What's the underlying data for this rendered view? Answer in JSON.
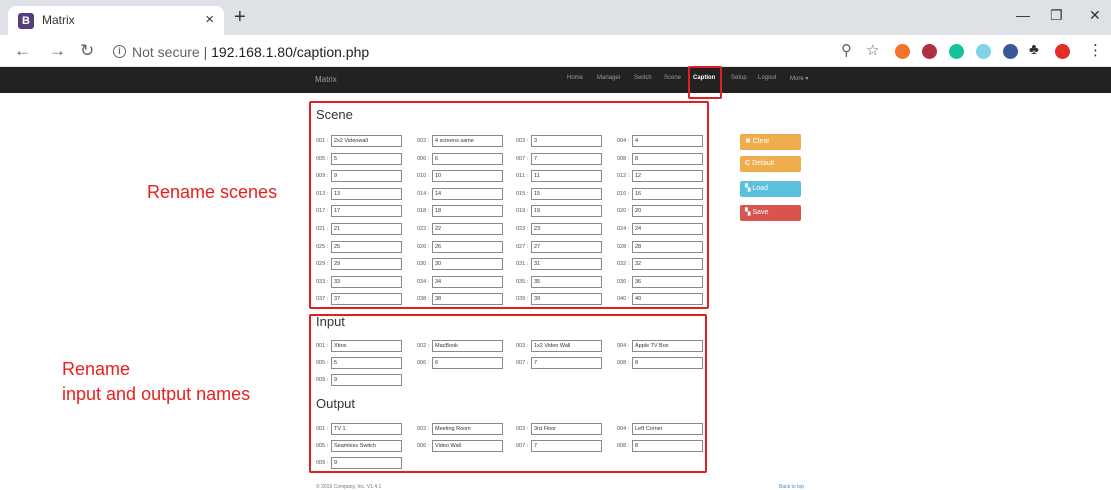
{
  "browser": {
    "tab_title": "Matrix",
    "favicon_letter": "B",
    "new_tab": "+",
    "close_tab": "×",
    "url_security": "Not secure",
    "url_separator": "|",
    "url_host": "192.168.1.80/caption.php"
  },
  "navbar": {
    "brand": "Matrix",
    "items": [
      "Home",
      "Manager",
      "Switch",
      "Scene",
      "Caption",
      "Setup",
      "Logout",
      "More ▾"
    ],
    "active": "Caption"
  },
  "scene": {
    "title": "Scene",
    "items": [
      {
        "label": "001 :",
        "value": "2x2 Videowall"
      },
      {
        "label": "002 :",
        "value": "4 screens same"
      },
      {
        "label": "003 :",
        "value": "3"
      },
      {
        "label": "004 :",
        "value": "4"
      },
      {
        "label": "005 :",
        "value": "5"
      },
      {
        "label": "006 :",
        "value": "6"
      },
      {
        "label": "007 :",
        "value": "7"
      },
      {
        "label": "008 :",
        "value": "8"
      },
      {
        "label": "009 :",
        "value": "9"
      },
      {
        "label": "010 :",
        "value": "10"
      },
      {
        "label": "011 :",
        "value": "11"
      },
      {
        "label": "012 :",
        "value": "12"
      },
      {
        "label": "013 :",
        "value": "13"
      },
      {
        "label": "014 :",
        "value": "14"
      },
      {
        "label": "015 :",
        "value": "15"
      },
      {
        "label": "016 :",
        "value": "16"
      },
      {
        "label": "017 :",
        "value": "17"
      },
      {
        "label": "018 :",
        "value": "18"
      },
      {
        "label": "019 :",
        "value": "19"
      },
      {
        "label": "020 :",
        "value": "20"
      },
      {
        "label": "021 :",
        "value": "21"
      },
      {
        "label": "022 :",
        "value": "22"
      },
      {
        "label": "023 :",
        "value": "23"
      },
      {
        "label": "024 :",
        "value": "24"
      },
      {
        "label": "025 :",
        "value": "25"
      },
      {
        "label": "026 :",
        "value": "26"
      },
      {
        "label": "027 :",
        "value": "27"
      },
      {
        "label": "028 :",
        "value": "28"
      },
      {
        "label": "029 :",
        "value": "29"
      },
      {
        "label": "030 :",
        "value": "30"
      },
      {
        "label": "031 :",
        "value": "31"
      },
      {
        "label": "032 :",
        "value": "32"
      },
      {
        "label": "033 :",
        "value": "33"
      },
      {
        "label": "034 :",
        "value": "34"
      },
      {
        "label": "035 :",
        "value": "35"
      },
      {
        "label": "036 :",
        "value": "36"
      },
      {
        "label": "037 :",
        "value": "37"
      },
      {
        "label": "038 :",
        "value": "38"
      },
      {
        "label": "039 :",
        "value": "39"
      },
      {
        "label": "040 :",
        "value": "40"
      }
    ]
  },
  "input": {
    "title": "Input",
    "items": [
      {
        "label": "001 :",
        "value": "Xbox"
      },
      {
        "label": "002 :",
        "value": "MacBook"
      },
      {
        "label": "003 :",
        "value": "1x2 Video Wall"
      },
      {
        "label": "004 :",
        "value": "Apple TV Box"
      },
      {
        "label": "005 :",
        "value": "5"
      },
      {
        "label": "006 :",
        "value": "6"
      },
      {
        "label": "007 :",
        "value": "7"
      },
      {
        "label": "008 :",
        "value": "8"
      },
      {
        "label": "009 :",
        "value": "9"
      }
    ]
  },
  "output": {
    "title": "Output",
    "items": [
      {
        "label": "001 :",
        "value": "TV 1"
      },
      {
        "label": "002 :",
        "value": "Meeting Room"
      },
      {
        "label": "003 :",
        "value": "3rd Floor"
      },
      {
        "label": "004 :",
        "value": "Left Corner"
      },
      {
        "label": "005 :",
        "value": "Seamless Switch"
      },
      {
        "label": "006 :",
        "value": "Video Wall"
      },
      {
        "label": "007 :",
        "value": "7"
      },
      {
        "label": "008 :",
        "value": "8"
      },
      {
        "label": "009 :",
        "value": "9"
      }
    ]
  },
  "actions": [
    {
      "icon": "✖",
      "label": "Clear",
      "color": "#f0ad4e",
      "name": "clear-button"
    },
    {
      "icon": "C",
      "label": "Default",
      "color": "#f0ad4e",
      "name": "default-button"
    },
    {
      "icon": "▚",
      "label": "Load",
      "color": "#5bc0de",
      "name": "load-button"
    },
    {
      "icon": "▚",
      "label": "Save",
      "color": "#d9534f",
      "name": "save-button"
    }
  ],
  "annotations": {
    "rename_scenes": "Rename scenes",
    "rename_io_line1": "Rename",
    "rename_io_line2": "input and output names"
  },
  "footer": {
    "copyright": "© 2019 Company, Inc. V1.4.1",
    "back_to_top": "Back to top"
  },
  "colors": {
    "annotation_red": "#e02020",
    "navbar_bg": "#222222"
  }
}
